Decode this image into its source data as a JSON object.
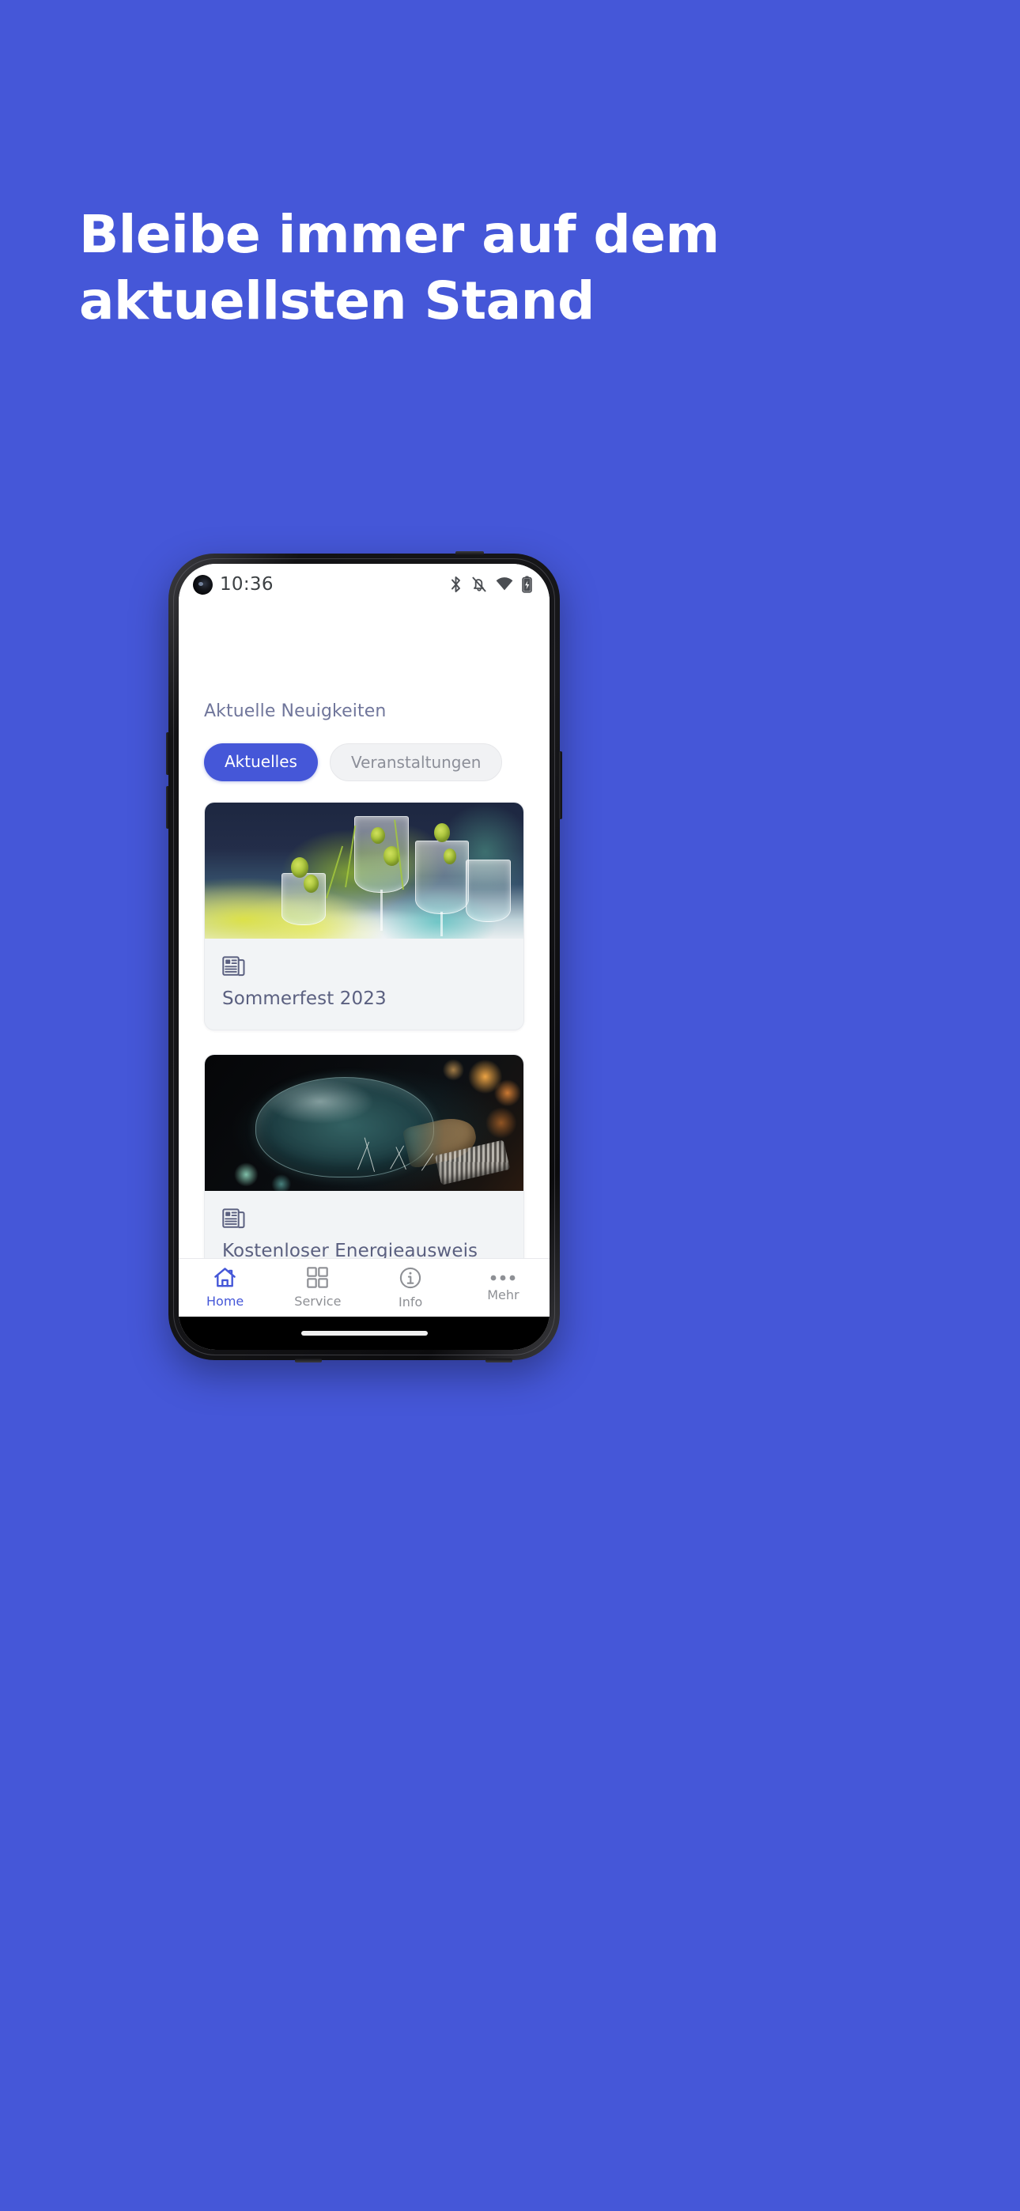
{
  "page": {
    "background_color": "#4557d8",
    "accent_color": "#4557d8"
  },
  "headline": {
    "line1": "Bleibe immer auf dem",
    "line2": "aktuellsten Stand",
    "color": "#ffffff"
  },
  "phone": {
    "status_bar": {
      "time": "10:36",
      "icons": [
        "bluetooth-icon",
        "notifications-muted-icon",
        "wifi-icon",
        "battery-charging-icon"
      ]
    },
    "app": {
      "section_title": "Aktuelle Neuigkeiten",
      "tabs": [
        {
          "label": "Aktuelles",
          "active": true
        },
        {
          "label": "Veranstaltungen",
          "active": false
        }
      ],
      "cards": [
        {
          "title": "Sommerfest 2023",
          "icon": "newspaper-icon",
          "image_alt": "festive-table-setting-with-wine-glasses-and-green-foliage"
        },
        {
          "title": "Kostenloser Energieausweis",
          "icon": "newspaper-icon",
          "image_alt": "vintage-light-bulb-with-orange-bokeh"
        }
      ],
      "bottom_nav": [
        {
          "label": "Home",
          "icon": "home-icon",
          "active": true
        },
        {
          "label": "Service",
          "icon": "grid-icon",
          "active": false
        },
        {
          "label": "Info",
          "icon": "info-icon",
          "active": false
        },
        {
          "label": "Mehr",
          "icon": "ellipsis-icon",
          "active": false
        }
      ]
    }
  }
}
